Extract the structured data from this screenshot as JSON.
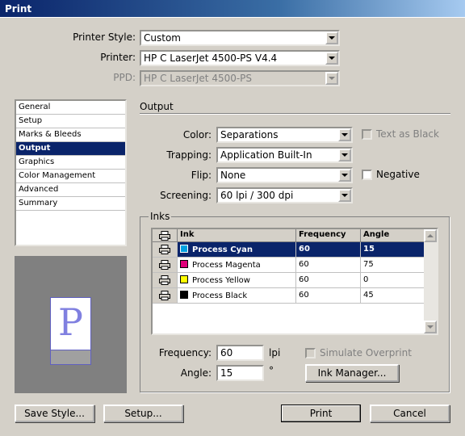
{
  "window": {
    "title": "Print"
  },
  "top": {
    "printer_style_label": "Printer Style:",
    "printer_style_value": "Custom",
    "printer_label": "Printer:",
    "printer_value": "HP C LaserJet 4500-PS V4.4",
    "ppd_label": "PPD:",
    "ppd_value": "HP C LaserJet 4500-PS"
  },
  "sidebar": {
    "items": [
      {
        "label": "General",
        "selected": false
      },
      {
        "label": "Setup",
        "selected": false
      },
      {
        "label": "Marks & Bleeds",
        "selected": false
      },
      {
        "label": "Output",
        "selected": true
      },
      {
        "label": "Graphics",
        "selected": false
      },
      {
        "label": "Color Management",
        "selected": false
      },
      {
        "label": "Advanced",
        "selected": false
      },
      {
        "label": "Summary",
        "selected": false
      }
    ]
  },
  "preview": {
    "glyph": "P"
  },
  "output": {
    "heading": "Output",
    "color_label": "Color:",
    "color_value": "Separations",
    "text_as_black_label": "Text as Black",
    "trapping_label": "Trapping:",
    "trapping_value": "Application Built-In",
    "flip_label": "Flip:",
    "flip_value": "None",
    "negative_label": "Negative",
    "screening_label": "Screening:",
    "screening_value": "60 lpi / 300 dpi"
  },
  "inks": {
    "group_label": "Inks",
    "columns": [
      "Ink",
      "Frequency",
      "Angle"
    ],
    "rows": [
      {
        "name": "Process Cyan",
        "frequency": "60",
        "angle": "15",
        "color": "#00a0e0",
        "selected": true
      },
      {
        "name": "Process Magenta",
        "frequency": "60",
        "angle": "75",
        "color": "#e0007a",
        "selected": false
      },
      {
        "name": "Process Yellow",
        "frequency": "60",
        "angle": "0",
        "color": "#ffff00",
        "selected": false
      },
      {
        "name": "Process Black",
        "frequency": "60",
        "angle": "45",
        "color": "#000000",
        "selected": false
      }
    ],
    "frequency_label": "Frequency:",
    "frequency_value": "60",
    "frequency_unit": "lpi",
    "angle_label": "Angle:",
    "angle_value": "15",
    "angle_unit": "°",
    "simulate_overprint_label": "Simulate Overprint",
    "ink_manager_label": "Ink Manager..."
  },
  "buttons": {
    "save_style": "Save Style...",
    "setup": "Setup...",
    "print": "Print",
    "cancel": "Cancel"
  },
  "colors": {
    "accent": "#0a246a",
    "face": "#d4d0c8"
  }
}
